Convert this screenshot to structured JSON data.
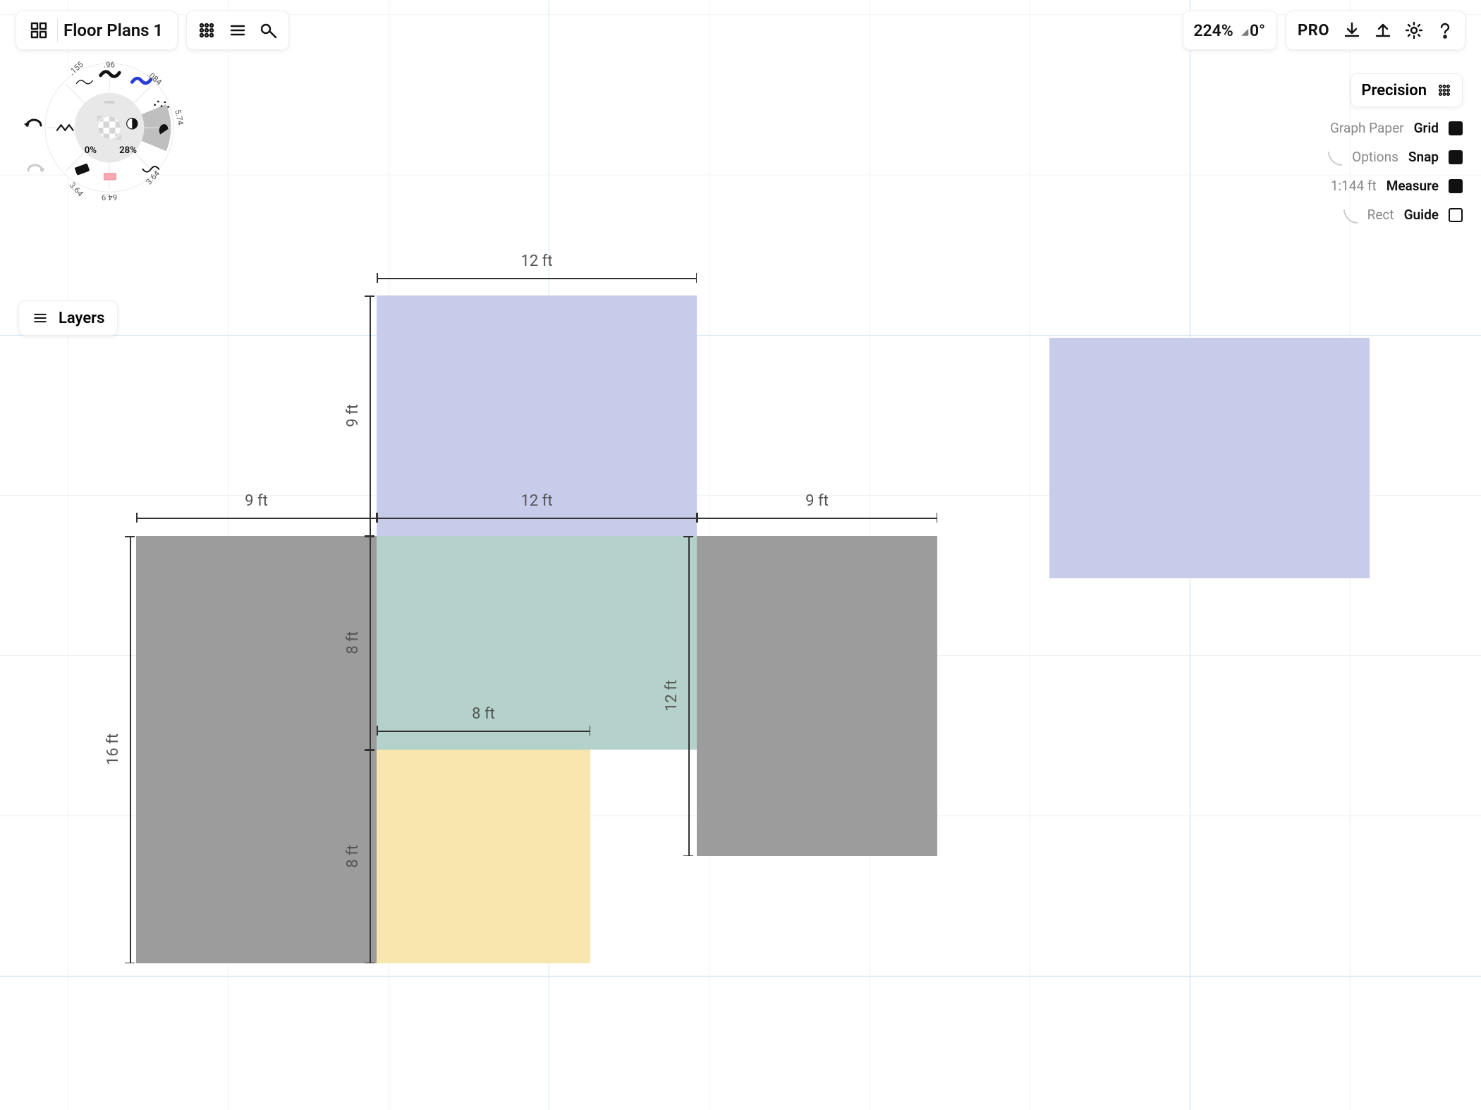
{
  "toolbar": {
    "doc_title": "Floor Plans 1",
    "zoom": "224%",
    "angle": "0°",
    "pro_label": "PRO"
  },
  "precision": {
    "title": "Precision",
    "grid": {
      "hint": "Graph Paper",
      "label": "Grid",
      "state": "solid"
    },
    "snap": {
      "hint": "Options",
      "label": "Snap",
      "state": "solid"
    },
    "measure": {
      "hint": "1:144 ft",
      "label": "Measure",
      "state": "solid"
    },
    "guide": {
      "hint": "Rect",
      "label": "Guide",
      "state": "hollow"
    }
  },
  "layers": {
    "label": "Layers"
  },
  "wheel": {
    "top_labels": [
      ".155",
      ".96",
      ".084"
    ],
    "right_label": "5.74",
    "bottom_labels": [
      "3.64",
      "64.9",
      "3.64"
    ],
    "hue": "0%",
    "opacity": "28%"
  },
  "dimensions": {
    "top_12": "12 ft",
    "left_9": "9 ft",
    "mid_9_l": "9 ft",
    "mid_12": "12 ft",
    "mid_9_r": "9 ft",
    "left_8_up": "8 ft",
    "left_8_dn": "8 ft",
    "far_16": "16 ft",
    "inner_8": "8 ft",
    "right_12_v": "12 ft"
  },
  "shapes": {
    "lavender_top": {
      "color": "#c7cceb"
    },
    "lavender_right": {
      "color": "#c7cceb"
    },
    "teal": {
      "color": "#b4d2cb"
    },
    "yellow": {
      "color": "#f7e6ad"
    },
    "gray_left": {
      "color": "#9c9c9c"
    },
    "gray_right": {
      "color": "#9c9c9c"
    }
  }
}
